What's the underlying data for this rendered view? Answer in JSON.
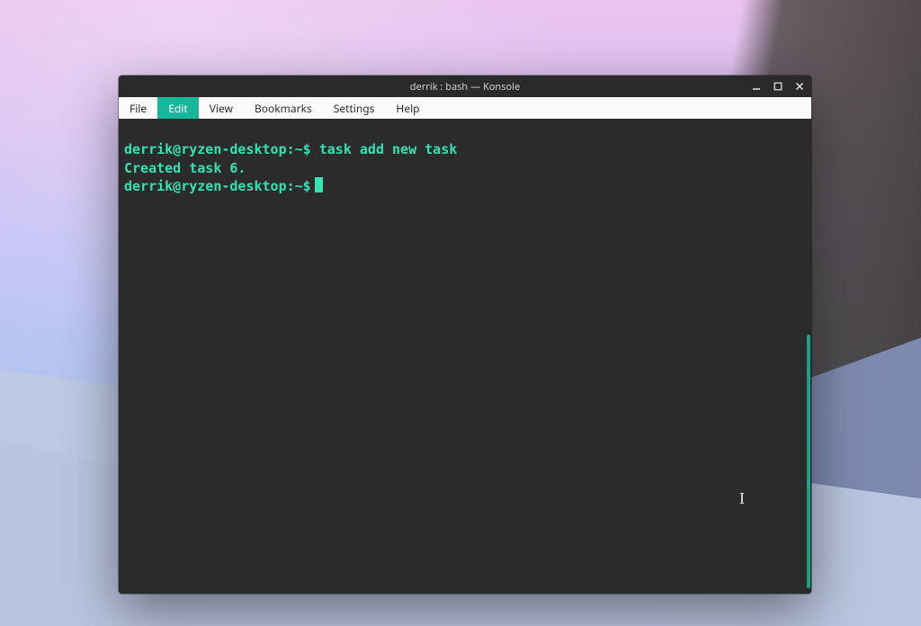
{
  "window": {
    "title": "derrik : bash — Konsole"
  },
  "menubar": {
    "items": [
      "File",
      "Edit",
      "View",
      "Bookmarks",
      "Settings",
      "Help"
    ],
    "active_index": 1
  },
  "terminal": {
    "lines": [
      {
        "prompt": "derrik@ryzen-desktop:~$",
        "command": "task add new task"
      },
      {
        "output": "Created task 6."
      },
      {
        "prompt": "derrik@ryzen-desktop:~$",
        "cursor": true
      }
    ]
  },
  "colors": {
    "accent": "#17b89a",
    "prompt": "#34e2b4",
    "terminal_bg": "#2b2b2b",
    "window_chrome": "#2a2a2a",
    "menubar_bg": "#fbfbfb"
  }
}
